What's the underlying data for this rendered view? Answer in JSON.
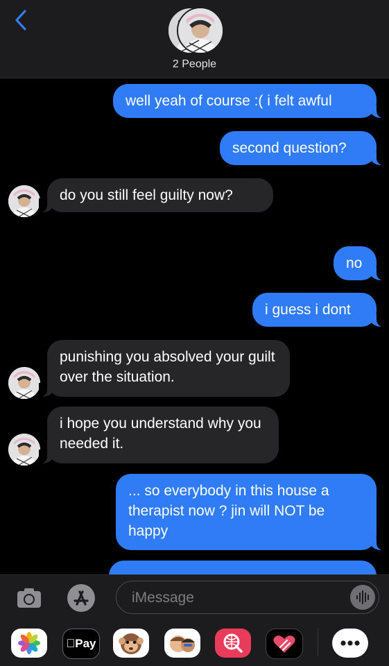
{
  "header": {
    "back_icon": "chevron-left-icon",
    "group_label": "2 People"
  },
  "messages": [
    {
      "dir": "out",
      "text": "well yeah of course :( i felt awful"
    },
    {
      "dir": "out",
      "text": "second question?"
    },
    {
      "dir": "in",
      "text": "do you still feel guilty now?"
    },
    {
      "dir": "out",
      "text": "no"
    },
    {
      "dir": "out",
      "text": "i guess i dont"
    },
    {
      "dir": "in",
      "text": "punishing you absolved your guilt over the situation."
    },
    {
      "dir": "in",
      "text": "i hope you understand why you needed it."
    },
    {
      "dir": "out",
      "text": "... so everybody in this house a therapist now ? jin will NOT be happy"
    }
  ],
  "input": {
    "placeholder": "iMessage",
    "camera_icon": "camera-icon",
    "appstore_icon": "app-store-icon",
    "audio_icon": "waveform-icon"
  },
  "apps": [
    {
      "name": "photos-app-icon"
    },
    {
      "name": "apple-pay-app-icon",
      "label": "Pay"
    },
    {
      "name": "animoji-app-icon"
    },
    {
      "name": "memoji-app-icon"
    },
    {
      "name": "web-search-app-icon"
    },
    {
      "name": "digital-touch-app-icon"
    },
    {
      "name": "more-apps-icon"
    }
  ],
  "colors": {
    "outgoing": "#2f7cf6",
    "incoming": "#262628",
    "bar": "#1c1c1e"
  }
}
